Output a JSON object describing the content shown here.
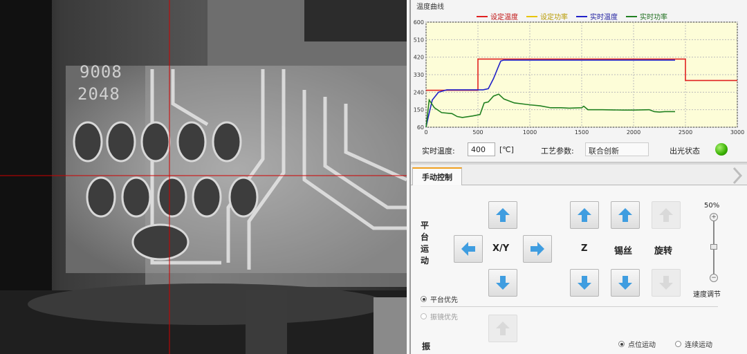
{
  "camera": {
    "chip_marking_1": "9008",
    "chip_marking_2": "2048"
  },
  "temp_panel": {
    "title": "温度曲线",
    "legend": [
      {
        "label": "设定温度",
        "color": "#e02020"
      },
      {
        "label": "设定功率",
        "color": "#e8c400"
      },
      {
        "label": "实时温度",
        "color": "#2020c8"
      },
      {
        "label": "实时功率",
        "color": "#208020"
      }
    ],
    "realtime_temp_label": "实时温度:",
    "realtime_temp_value": "400",
    "temp_unit": "[℃]",
    "process_param_label": "工艺参数:",
    "process_param_value": "联合创新",
    "light_status_label": "出光状态",
    "status_color": "#38b000"
  },
  "chart_data": {
    "type": "line",
    "x_ticks": [
      "0",
      "500",
      "1000",
      "1500",
      "2000",
      "2500",
      "3000"
    ],
    "y_ticks": [
      "60",
      "150",
      "240",
      "330",
      "420",
      "510",
      "600"
    ],
    "xlim": [
      0,
      3000
    ],
    "ylim": [
      60,
      600
    ],
    "grid": true,
    "series": [
      {
        "name": "设定温度",
        "color": "#e02020",
        "x": [
          0,
          500,
          500,
          2500,
          2500,
          3000
        ],
        "y": [
          250,
          250,
          410,
          410,
          300,
          300
        ]
      },
      {
        "name": "实时温度",
        "color": "#2020c8",
        "x": [
          0,
          20,
          60,
          120,
          200,
          300,
          450,
          550,
          600,
          650,
          700,
          720,
          750,
          1000,
          1500,
          2000,
          2400
        ],
        "y": [
          60,
          110,
          200,
          240,
          252,
          252,
          252,
          252,
          258,
          310,
          375,
          400,
          405,
          405,
          405,
          405,
          405
        ]
      },
      {
        "name": "实时功率",
        "color": "#208020",
        "x": [
          0,
          30,
          80,
          150,
          250,
          300,
          350,
          450,
          520,
          560,
          600,
          650,
          700,
          750,
          850,
          1000,
          1100,
          1200,
          1300,
          1380,
          1500,
          1520,
          1560,
          1700,
          1900,
          2000,
          2150,
          2200,
          2250,
          2300,
          2400
        ],
        "y": [
          60,
          200,
          160,
          135,
          130,
          115,
          110,
          118,
          125,
          185,
          190,
          220,
          230,
          205,
          185,
          175,
          170,
          160,
          160,
          158,
          160,
          168,
          150,
          150,
          148,
          148,
          150,
          140,
          138,
          140,
          140
        ]
      }
    ]
  },
  "control_panel": {
    "tab_label": "手动控制",
    "platform_motion_label": "平台运动",
    "xy_label": "X/Y",
    "z_label": "Z",
    "solder_label": "锡丝",
    "rotate_label": "旋转",
    "speed_percent": "50%",
    "speed_adjust_label": "速度调节",
    "radio_platform_first": "平台优先",
    "radio_galvo_first": "振镜优先",
    "galvo_label": "振",
    "radio_point_motion": "点位运动",
    "radio_continuous_motion": "连续运动"
  }
}
